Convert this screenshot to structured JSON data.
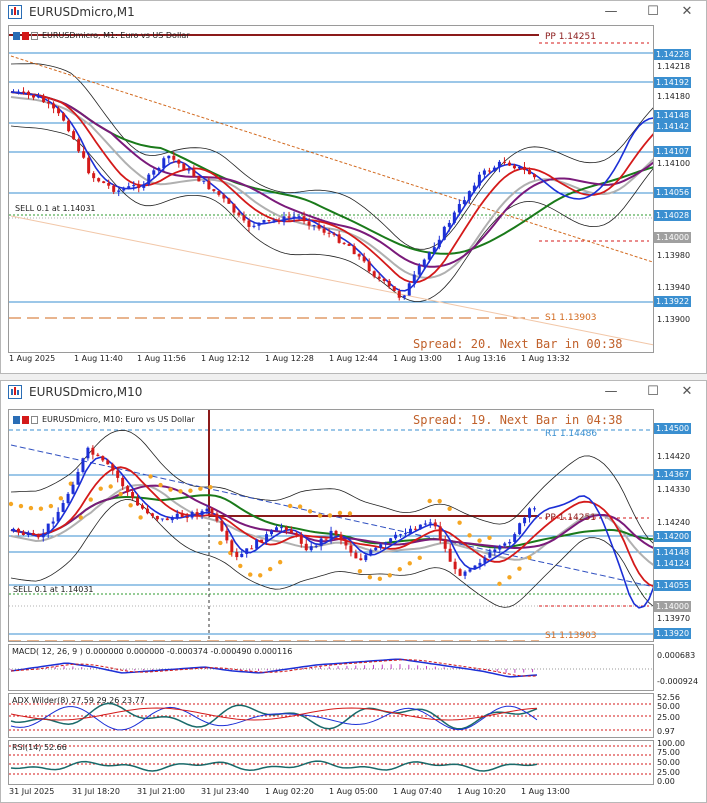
{
  "colors": {
    "buy_line": "#1f4fd8",
    "level_line": "#3a8fd0",
    "pp": "#8b1a1a",
    "s1": "#d2691e",
    "r1": "#3a8fd0",
    "spread": "#c0602a",
    "bull": "#1c2fd6",
    "bear": "#d41a1a",
    "sar": "#f5a623",
    "ma_green": "#1a7a1a",
    "ma_purple": "#7a1a7a",
    "ma_red": "#d41a1a",
    "ma_gray": "#b0b0b0"
  },
  "window1": {
    "title": "EURUSDmicro,M1",
    "symbol_label": "EURUSDmicro, M1:  Euro vs US Dollar",
    "spread_text": "Spread: 20. Next Bar in 00:38",
    "pp_label": "PP 1.14251",
    "s1_label": "S1 1.13903",
    "sell_label": "SELL 0.1 at 1.14031",
    "price_tags": [
      "1.14228",
      "1.14192",
      "1.14148",
      "1.14142",
      "1.14107",
      "1.14056",
      "1.14028",
      "1.14000",
      "1.13922"
    ],
    "price_axis": [
      "1.14218",
      "1.14180",
      "1.14100",
      "1.13980",
      "1.13940",
      "1.13900"
    ],
    "time_axis": [
      "1 Aug 2025",
      "1 Aug 11:40",
      "1 Aug 11:56",
      "1 Aug 12:12",
      "1 Aug 12:28",
      "1 Aug 12:44",
      "1 Aug 13:00",
      "1 Aug 13:16",
      "1 Aug 13:32"
    ]
  },
  "window2": {
    "title": "EURUSDmicro,M10",
    "symbol_label": "EURUSDmicro, M10:  Euro vs US Dollar",
    "spread_text": "Spread: 19. Next Bar in 04:38",
    "pp_label": "PP 1.14251",
    "r1_label": "R1 1.14486",
    "s1_label": "S1 1.13903",
    "sell_label": "SELL 0.1 at 1.14031",
    "price_tags": [
      "1.14500",
      "1.14367",
      "1.14200",
      "1.14148",
      "1.14124",
      "1.14055",
      "1.14000",
      "1.13920"
    ],
    "price_axis": [
      "1.14420",
      "1.14330",
      "1.14240",
      "1.13970"
    ],
    "macd_label": "MACD( 12, 26, 9 ) 0.000000 0.000000 -0.000374 -0.000490 0.000116",
    "macd_axis": [
      "0.000683",
      "-0.000924"
    ],
    "adx_label": "ADX Wilder(8) 27.59 29.26 23.77",
    "adx_axis": [
      "52.56",
      "50.00",
      "25.00",
      "0.97"
    ],
    "rsi_label": "RSI(14) 52.66",
    "rsi_axis": [
      "100.00",
      "75.00",
      "50.00",
      "25.00",
      "0.00"
    ],
    "time_axis": [
      "31 Jul 2025",
      "31 Jul 18:20",
      "31 Jul 21:00",
      "31 Jul 23:40",
      "1 Aug 02:20",
      "1 Aug 05:00",
      "1 Aug 07:40",
      "1 Aug 10:20",
      "1 Aug 13:00"
    ]
  },
  "window_buttons": {
    "minimize": "—",
    "maximize": "☐",
    "close": "✕"
  }
}
